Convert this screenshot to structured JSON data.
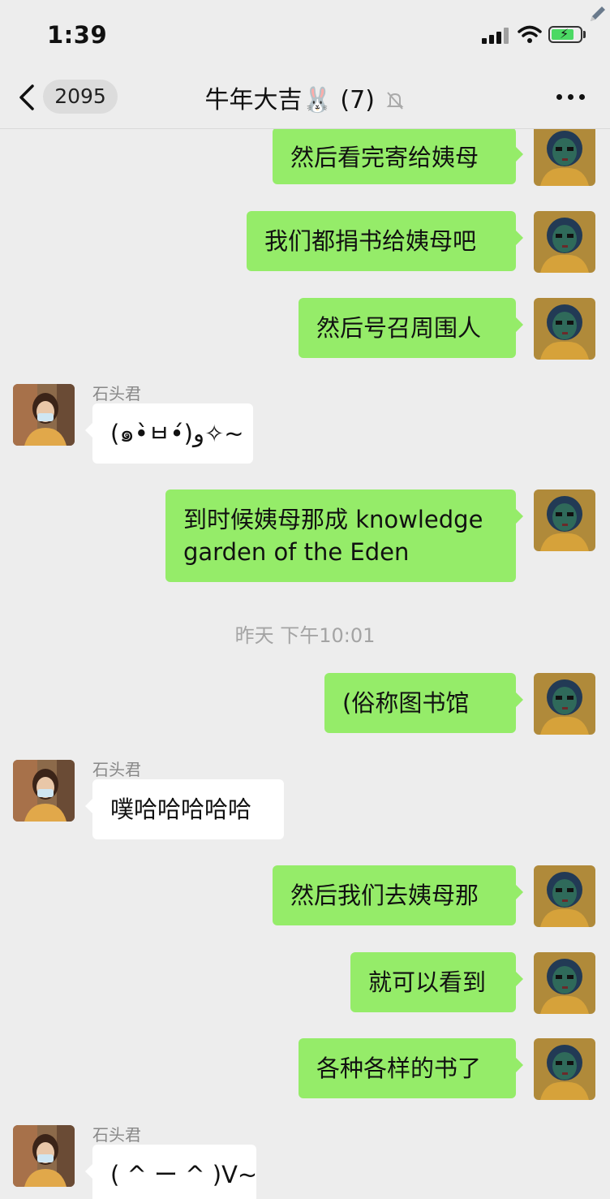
{
  "status_bar": {
    "time": "1:39"
  },
  "nav": {
    "back_count": "2095",
    "title": "牛年大吉🐰 (7)"
  },
  "colors": {
    "self_bubble": "#95ec69",
    "other_bubble": "#ffffff",
    "background": "#ededed"
  },
  "messages": [
    {
      "from": "me",
      "text": "然后看完寄给姨母"
    },
    {
      "from": "me",
      "text": "我们都捐书给姨母吧"
    },
    {
      "from": "me",
      "text": "然后号召周围人"
    },
    {
      "from": "other",
      "sender": "石头君",
      "text": "(๑•̀ㅂ•́)و✧~"
    },
    {
      "from": "me",
      "text": "到时候姨母那成 knowledge\ngarden of the Eden"
    },
    {
      "timestamp": "昨天 下午10:01"
    },
    {
      "from": "me",
      "text": "(俗称图书馆"
    },
    {
      "from": "other",
      "sender": "石头君",
      "text": "噗哈哈哈哈哈"
    },
    {
      "from": "me",
      "text": "然后我们去姨母那"
    },
    {
      "from": "me",
      "text": "就可以看到"
    },
    {
      "from": "me",
      "text": "各种各样的书了"
    },
    {
      "from": "other",
      "sender": "石头君",
      "text": "( ^ ー ^ )V~"
    }
  ]
}
